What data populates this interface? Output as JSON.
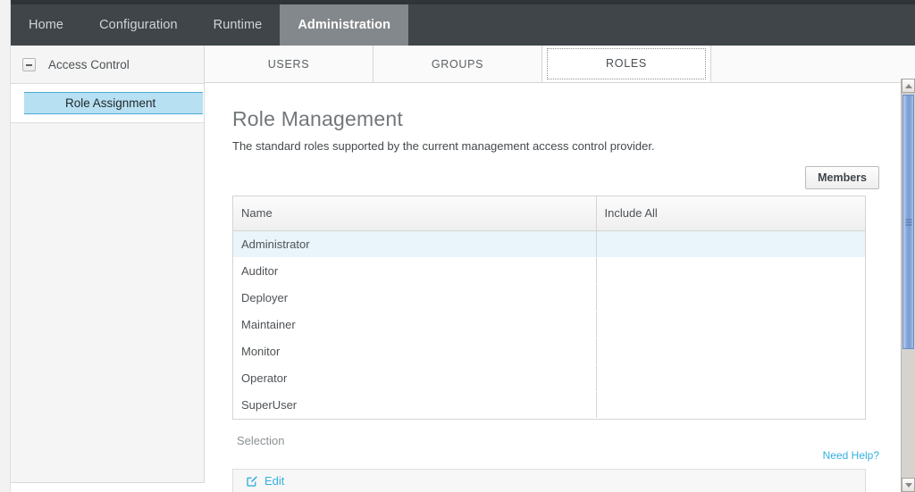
{
  "nav": {
    "items": [
      {
        "label": "Home",
        "active": false
      },
      {
        "label": "Configuration",
        "active": false
      },
      {
        "label": "Runtime",
        "active": false
      },
      {
        "label": "Administration",
        "active": true
      }
    ]
  },
  "sidebar": {
    "section": {
      "label": "Access Control",
      "collapse_icon": "minus-box-icon"
    },
    "items": [
      {
        "label": "Role Assignment",
        "active": true
      }
    ]
  },
  "tabs": [
    {
      "label": "USERS",
      "active": false
    },
    {
      "label": "GROUPS",
      "active": false
    },
    {
      "label": "ROLES",
      "active": true
    }
  ],
  "main": {
    "title": "Role Management",
    "description": "The standard roles supported by the current management access control provider.",
    "members_button": "Members",
    "selection_label": "Selection",
    "need_help": "Need Help?",
    "edit_label": "Edit",
    "edit_icon": "pencil-square-icon"
  },
  "table": {
    "columns": [
      "Name",
      "Include All"
    ],
    "rows": [
      {
        "name": "Administrator",
        "include_all": "",
        "selected": true
      },
      {
        "name": "Auditor",
        "include_all": "",
        "selected": false
      },
      {
        "name": "Deployer",
        "include_all": "",
        "selected": false
      },
      {
        "name": "Maintainer",
        "include_all": "",
        "selected": false
      },
      {
        "name": "Monitor",
        "include_all": "",
        "selected": false
      },
      {
        "name": "Operator",
        "include_all": "",
        "selected": false
      },
      {
        "name": "SuperUser",
        "include_all": "",
        "selected": false
      }
    ]
  },
  "scrollbar": {
    "up_icon": "chevron-up-icon",
    "down_icon": "chevron-down-icon"
  },
  "colors": {
    "nav_bg": "#3f4549",
    "nav_active_bg": "#83888c",
    "sidebar_active_bg": "#b7e0f2",
    "sidebar_active_border": "#4aa8d8",
    "link": "#36b0df",
    "row_selected_bg": "#eaf4fb",
    "scroll_thumb": "#7e9fd6"
  }
}
